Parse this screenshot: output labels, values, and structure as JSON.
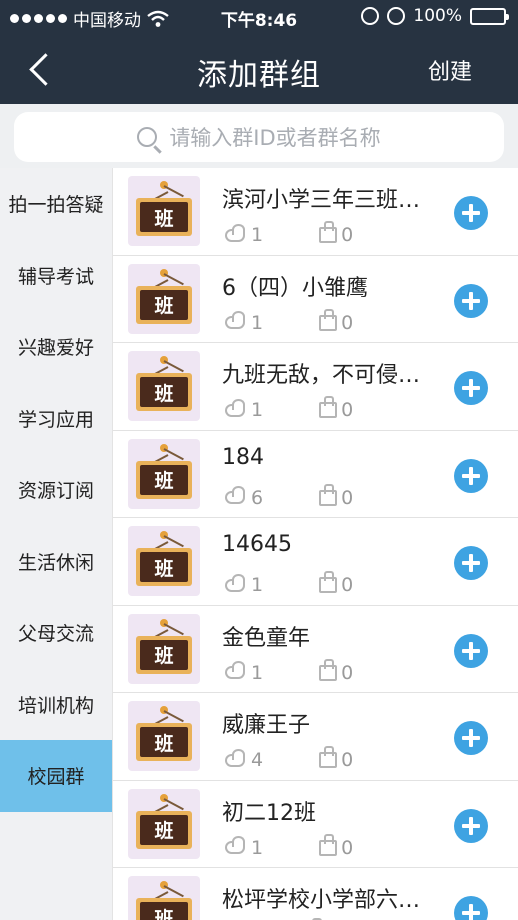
{
  "status_bar": {
    "carrier": "中国移动",
    "time": "下午8:46",
    "battery": "100%"
  },
  "nav": {
    "title": "添加群组",
    "create_label": "创建"
  },
  "search": {
    "placeholder": "请输入群ID或者群名称"
  },
  "sidebar": {
    "items": [
      {
        "label": "拍一拍答疑",
        "active": false
      },
      {
        "label": "辅导考试",
        "active": false
      },
      {
        "label": "兴趣爱好",
        "active": false
      },
      {
        "label": "学习应用",
        "active": false
      },
      {
        "label": "资源订阅",
        "active": false
      },
      {
        "label": "生活休闲",
        "active": false
      },
      {
        "label": "父母交流",
        "active": false
      },
      {
        "label": "培训机构",
        "active": false
      },
      {
        "label": "校园群",
        "active": true
      }
    ]
  },
  "groups": [
    {
      "name": "滨河小学三年三班…",
      "members": "1",
      "likes": "0",
      "badge": "班"
    },
    {
      "name": "6（四）小雏鹰",
      "members": "1",
      "likes": "0",
      "badge": "班"
    },
    {
      "name": "九班无敌，不可侵…",
      "members": "1",
      "likes": "0",
      "badge": "班"
    },
    {
      "name": "184",
      "members": "6",
      "likes": "0",
      "badge": "班"
    },
    {
      "name": "14645",
      "members": "1",
      "likes": "0",
      "badge": "班"
    },
    {
      "name": "金色童年",
      "members": "1",
      "likes": "0",
      "badge": "班"
    },
    {
      "name": "威廉王子",
      "members": "4",
      "likes": "0",
      "badge": "班"
    },
    {
      "name": "初二12班",
      "members": "1",
      "likes": "0",
      "badge": "班"
    },
    {
      "name": "松坪学校小学部六…",
      "members": "",
      "likes": "",
      "badge": "班"
    }
  ]
}
